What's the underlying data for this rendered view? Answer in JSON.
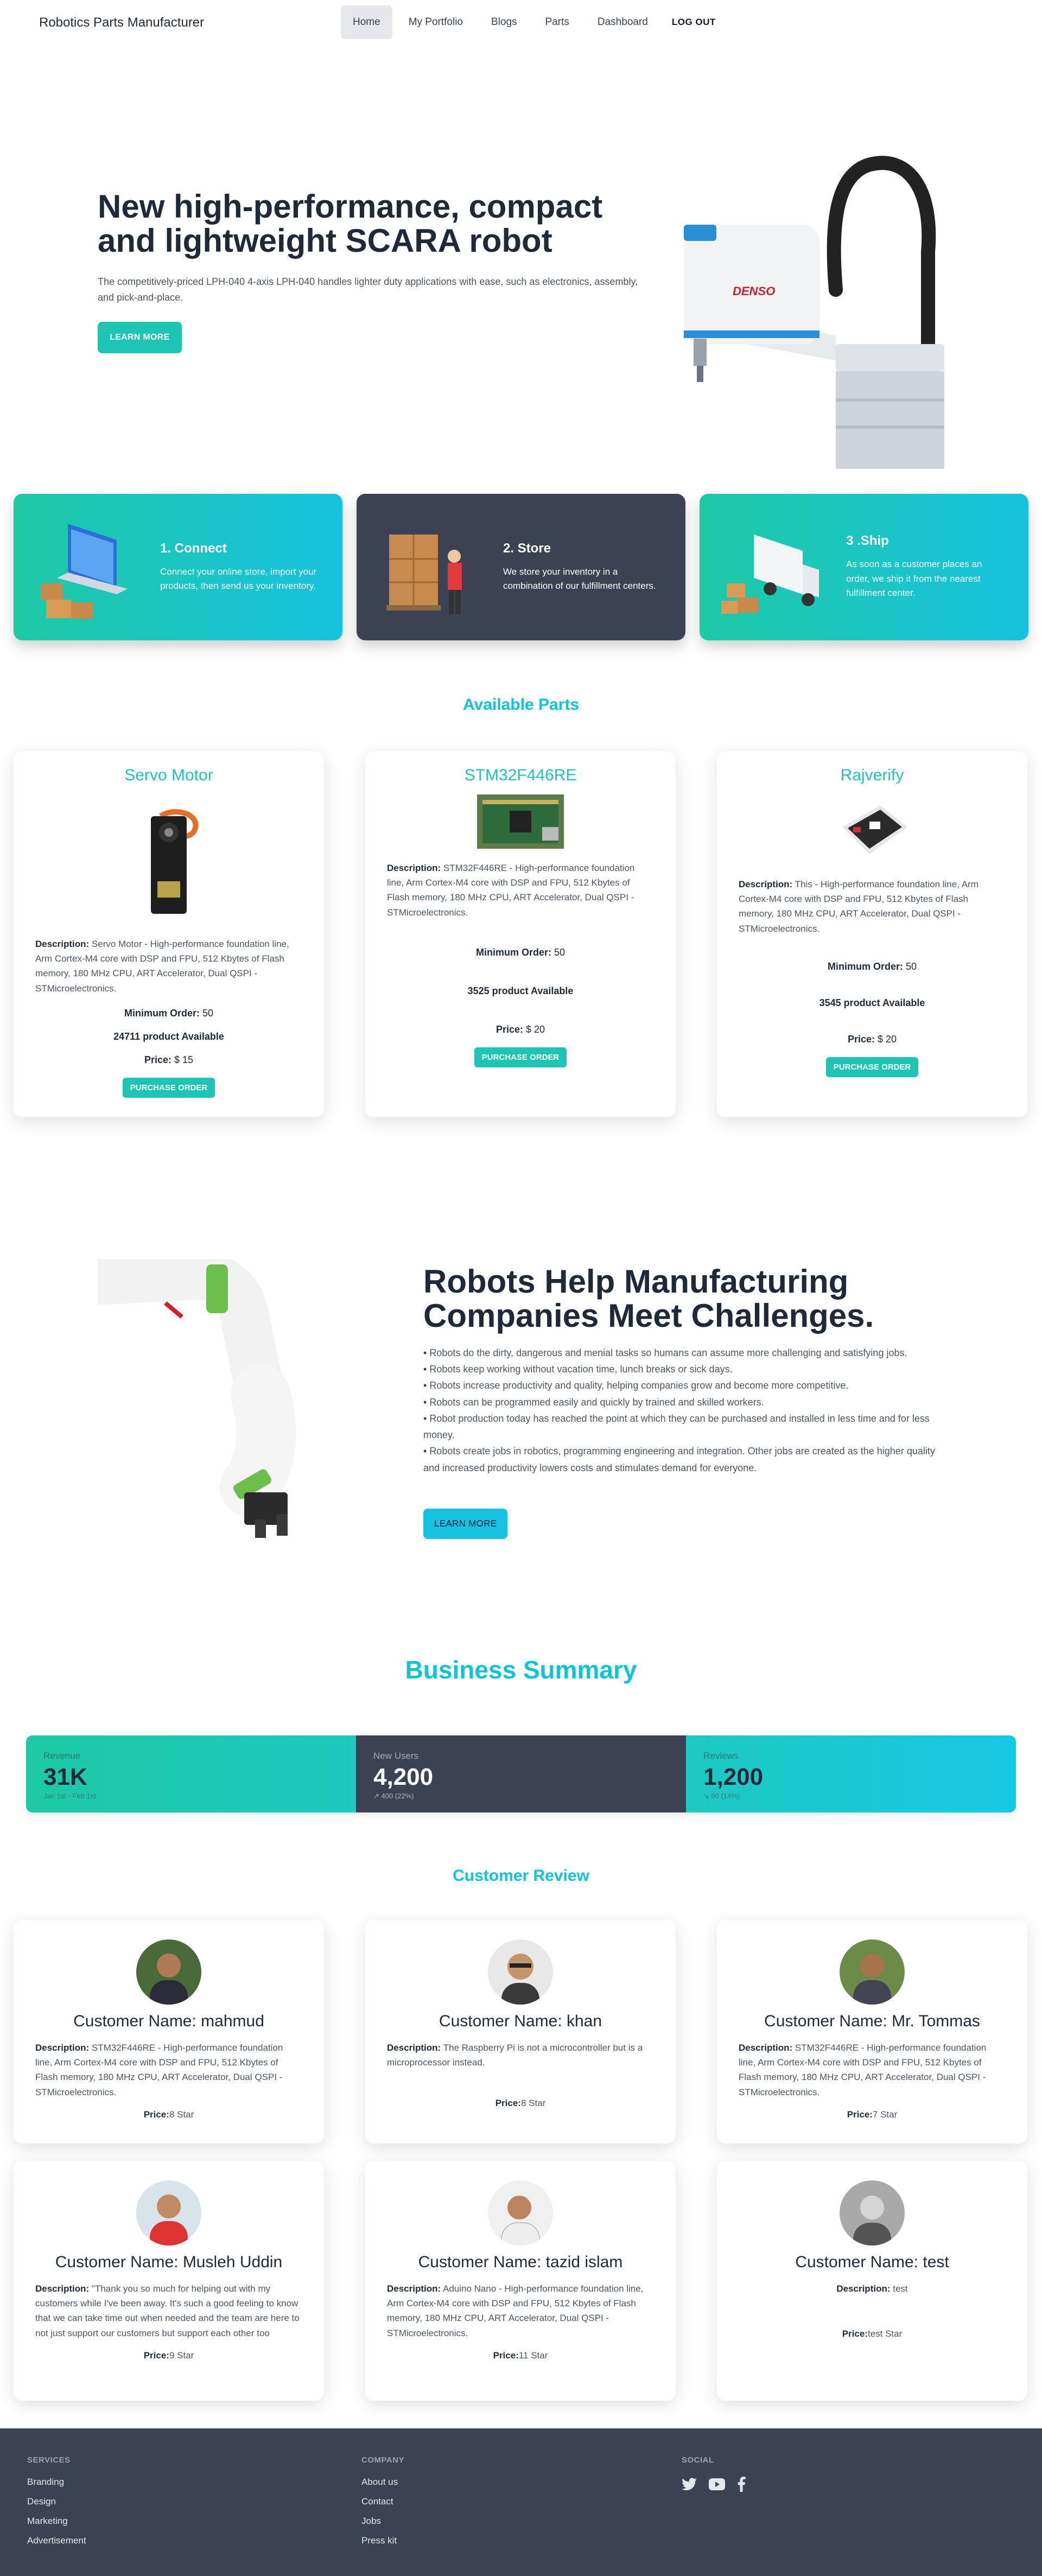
{
  "nav": {
    "brand": "Robotics Parts Manufacturer",
    "links": [
      "Home",
      "My Portfolio",
      "Blogs",
      "Parts",
      "Dashboard"
    ],
    "logout": "LOG OUT"
  },
  "hero": {
    "title": "New high-performance, compact and lightweight SCARA robot",
    "description": "The competitively-priced LPH-040 4-axis LPH-040 handles lighter duty applications with ease, such as electronics, assembly, and pick-and-place.",
    "button": "LEARN MORE",
    "robot_brand": "DENSO"
  },
  "steps": [
    {
      "title": "1. Connect",
      "desc": "Connect your online store, import your products, then send us your inventory."
    },
    {
      "title": "2. Store",
      "desc": "We store your inventory in a combination of our fulfillment centers."
    },
    {
      "title": "3 .Ship",
      "desc": "As soon as a customer places an order, we ship it from the nearest fulfillment center."
    }
  ],
  "parts_section": {
    "title": "Available Parts",
    "labels": {
      "description": "Description:",
      "min_order": "Minimum Order:",
      "price": "Price:",
      "available_suffix": "product Available",
      "button": "PURCHASE ORDER"
    },
    "items": [
      {
        "name": "Servo Motor",
        "desc": "Servo Motor - High-performance foundation line, Arm Cortex-M4 core with DSP and FPU, 512 Kbytes of Flash memory, 180 MHz CPU, ART Accelerator, Dual QSPI - STMicroelectronics.",
        "min_order": "50",
        "available": "24711",
        "price": "$ 15"
      },
      {
        "name": "STM32F446RE",
        "desc": "STM32F446RE - High-performance foundation line, Arm Cortex-M4 core with DSP and FPU, 512 Kbytes of Flash memory, 180 MHz CPU, ART Accelerator, Dual QSPI - STMicroelectronics.",
        "min_order": "50",
        "available": "3525",
        "price": "$ 20"
      },
      {
        "name": "Rajverify",
        "desc": "This - High-performance foundation line, Arm Cortex-M4 core with DSP and FPU, 512 Kbytes of Flash memory, 180 MHz CPU, ART Accelerator, Dual QSPI - STMicroelectronics.",
        "min_order": "50",
        "available": "3545",
        "price": "$ 20"
      }
    ]
  },
  "robots": {
    "title": "Robots Help Manufacturing Companies Meet Challenges.",
    "bullets": [
      "Robots do the dirty, dangerous and menial tasks so humans can assume more challenging and satisfying jobs.",
      "Robots keep working without vacation time, lunch breaks or sick days.",
      "Robots increase productivity and quality, helping companies grow and become more competitive.",
      "Robots can be programmed easily and quickly by trained and skilled workers.",
      "Robot production today has reached the point at which they can be purchased and installed in less time and for less money.",
      "Robots create jobs in robotics, programming engineering and integration. Other jobs are created as the higher quality and increased productivity lowers costs and stimulates demand for everyone."
    ],
    "button": "LEARN MORE"
  },
  "summary": {
    "title": "Business Summary",
    "stats": [
      {
        "label": "Revenue",
        "value": "31K",
        "sub": "Jan 1st - Feb 1st"
      },
      {
        "label": "New Users",
        "value": "4,200",
        "sub": "↗︎ 400 (22%)"
      },
      {
        "label": "Reviews",
        "value": "1,200",
        "sub": "↘︎ 90 (14%)"
      }
    ]
  },
  "reviews": {
    "title": "Customer Review",
    "labels": {
      "name_prefix": "Customer Name: ",
      "description": "Description:",
      "price": "Price:"
    },
    "items": [
      {
        "name": "mahmud",
        "desc": "STM32F446RE - High-performance foundation line, Arm Cortex-M4 core with DSP and FPU, 512 Kbytes of Flash memory, 180 MHz CPU, ART Accelerator, Dual QSPI - STMicroelectronics.",
        "price": "8 Star"
      },
      {
        "name": "khan",
        "desc": "The Raspberry Pi is not a microcontroller but is a microprocessor instead.",
        "price": "8 Star"
      },
      {
        "name": "Mr. Tommas",
        "desc": "STM32F446RE - High-performance foundation line, Arm Cortex-M4 core with DSP and FPU, 512 Kbytes of Flash memory, 180 MHz CPU, ART Accelerator, Dual QSPI - STMicroelectronics.",
        "price": "7 Star"
      },
      {
        "name": "Musleh Uddin",
        "desc": "\"Thank you so much for helping out with my customers while I've been away. It's such a good feeling to know that we can take time out when needed and the team are here to not just support our customers but support each other too",
        "price": "9 Star"
      },
      {
        "name": "tazid islam",
        "desc": "Aduino Nano - High-performance foundation line, Arm Cortex-M4 core with DSP and FPU, 512 Kbytes of Flash memory, 180 MHz CPU, ART Accelerator, Dual QSPI - STMicroelectronics.",
        "price": "11 Star"
      },
      {
        "name": "test",
        "desc": "test",
        "price": "test Star"
      }
    ]
  },
  "footer": {
    "services": {
      "title": "SERVICES",
      "links": [
        "Branding",
        "Design",
        "Marketing",
        "Advertisement"
      ]
    },
    "company": {
      "title": "COMPANY",
      "links": [
        "About us",
        "Contact",
        "Jobs",
        "Press kit"
      ]
    },
    "social": {
      "title": "SOCIAL",
      "icons": [
        "twitter-icon",
        "youtube-icon",
        "facebook-icon"
      ]
    }
  },
  "colors": {
    "accent_teal": "#1ec5b5",
    "accent_cyan": "#0fc4d9",
    "dark": "#3c4254"
  }
}
